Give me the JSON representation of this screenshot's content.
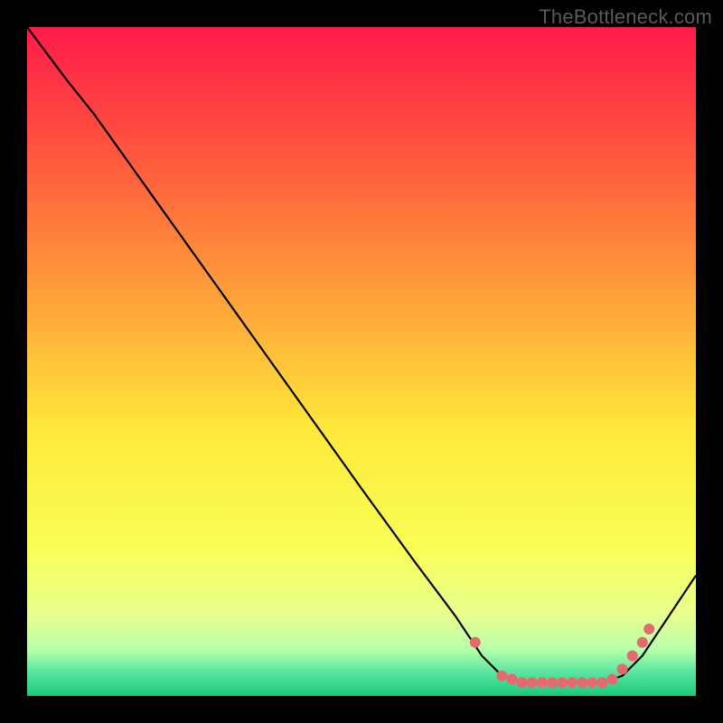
{
  "watermark": "TheBottleneck.com",
  "chart_data": {
    "type": "line",
    "title": "",
    "xlabel": "",
    "ylabel": "",
    "xlim": [
      0,
      100
    ],
    "ylim": [
      0,
      100
    ],
    "gradient_stops": [
      {
        "offset": 0.0,
        "color": "#ff1a4b"
      },
      {
        "offset": 0.2,
        "color": "#ff5a3c"
      },
      {
        "offset": 0.45,
        "color": "#ffb13a"
      },
      {
        "offset": 0.6,
        "color": "#ffe83a"
      },
      {
        "offset": 0.78,
        "color": "#f9ff57"
      },
      {
        "offset": 0.88,
        "color": "#e7ff8f"
      },
      {
        "offset": 0.93,
        "color": "#b8ffab"
      },
      {
        "offset": 0.965,
        "color": "#58e6a0"
      },
      {
        "offset": 1.0,
        "color": "#19c97a"
      }
    ],
    "series": [
      {
        "name": "bottleneck-curve",
        "stroke": "#000000",
        "points": [
          {
            "x": 0,
            "y": 100
          },
          {
            "x": 6,
            "y": 92
          },
          {
            "x": 10,
            "y": 87
          },
          {
            "x": 20,
            "y": 73
          },
          {
            "x": 30,
            "y": 59
          },
          {
            "x": 40,
            "y": 45
          },
          {
            "x": 50,
            "y": 31
          },
          {
            "x": 58,
            "y": 20
          },
          {
            "x": 64,
            "y": 12
          },
          {
            "x": 68,
            "y": 6
          },
          {
            "x": 71,
            "y": 3
          },
          {
            "x": 74,
            "y": 2
          },
          {
            "x": 78,
            "y": 2
          },
          {
            "x": 82,
            "y": 2
          },
          {
            "x": 86,
            "y": 2
          },
          {
            "x": 89,
            "y": 3
          },
          {
            "x": 92,
            "y": 6
          },
          {
            "x": 96,
            "y": 12
          },
          {
            "x": 100,
            "y": 18
          }
        ]
      }
    ],
    "markers": {
      "color": "#e56a6f",
      "radius": 6,
      "points": [
        {
          "x": 67,
          "y": 8
        },
        {
          "x": 71,
          "y": 3
        },
        {
          "x": 72.5,
          "y": 2.5
        },
        {
          "x": 74,
          "y": 2
        },
        {
          "x": 75.5,
          "y": 2
        },
        {
          "x": 77,
          "y": 2
        },
        {
          "x": 78.5,
          "y": 2
        },
        {
          "x": 80,
          "y": 2
        },
        {
          "x": 81.5,
          "y": 2
        },
        {
          "x": 83,
          "y": 2
        },
        {
          "x": 84.5,
          "y": 2
        },
        {
          "x": 86,
          "y": 2
        },
        {
          "x": 87.5,
          "y": 2.5
        },
        {
          "x": 89,
          "y": 4
        },
        {
          "x": 90.5,
          "y": 6
        },
        {
          "x": 92,
          "y": 8
        },
        {
          "x": 93,
          "y": 10
        }
      ]
    }
  }
}
